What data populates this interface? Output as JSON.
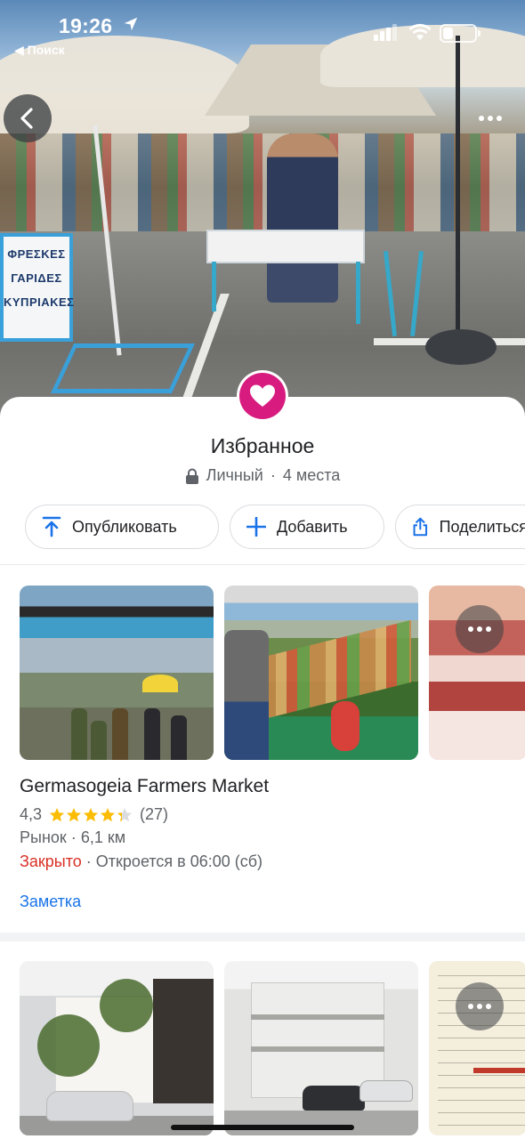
{
  "status_bar": {
    "time": "19:26",
    "back_app_label": "◀ Поиск"
  },
  "hero": {
    "sign_lines": [
      "ΦΡΕΣΚΕΣ",
      "ΓΑΡΙΔΕΣ",
      "ΚΥΠΡΙΑΚΕΣ"
    ]
  },
  "list": {
    "title": "Избранное",
    "visibility": "Личный",
    "separator": "·",
    "count": "4 места",
    "accent_color": "#d81b7f"
  },
  "actions": {
    "publish_label": "Опубликовать",
    "add_label": "Добавить",
    "share_label": "Поделиться"
  },
  "place": {
    "name": "Germasogeia Farmers Market",
    "rating": "4,3",
    "rating_stars": 4.3,
    "reviews": "(27)",
    "category": "Рынок",
    "distance": "6,1 км",
    "status_closed": "Закрыто",
    "opens": "Откроется в 06:00 (сб)",
    "note_label": "Заметка"
  },
  "colors": {
    "blue": "#1a73e8",
    "red": "#d93025",
    "star": "#fbbc04"
  }
}
